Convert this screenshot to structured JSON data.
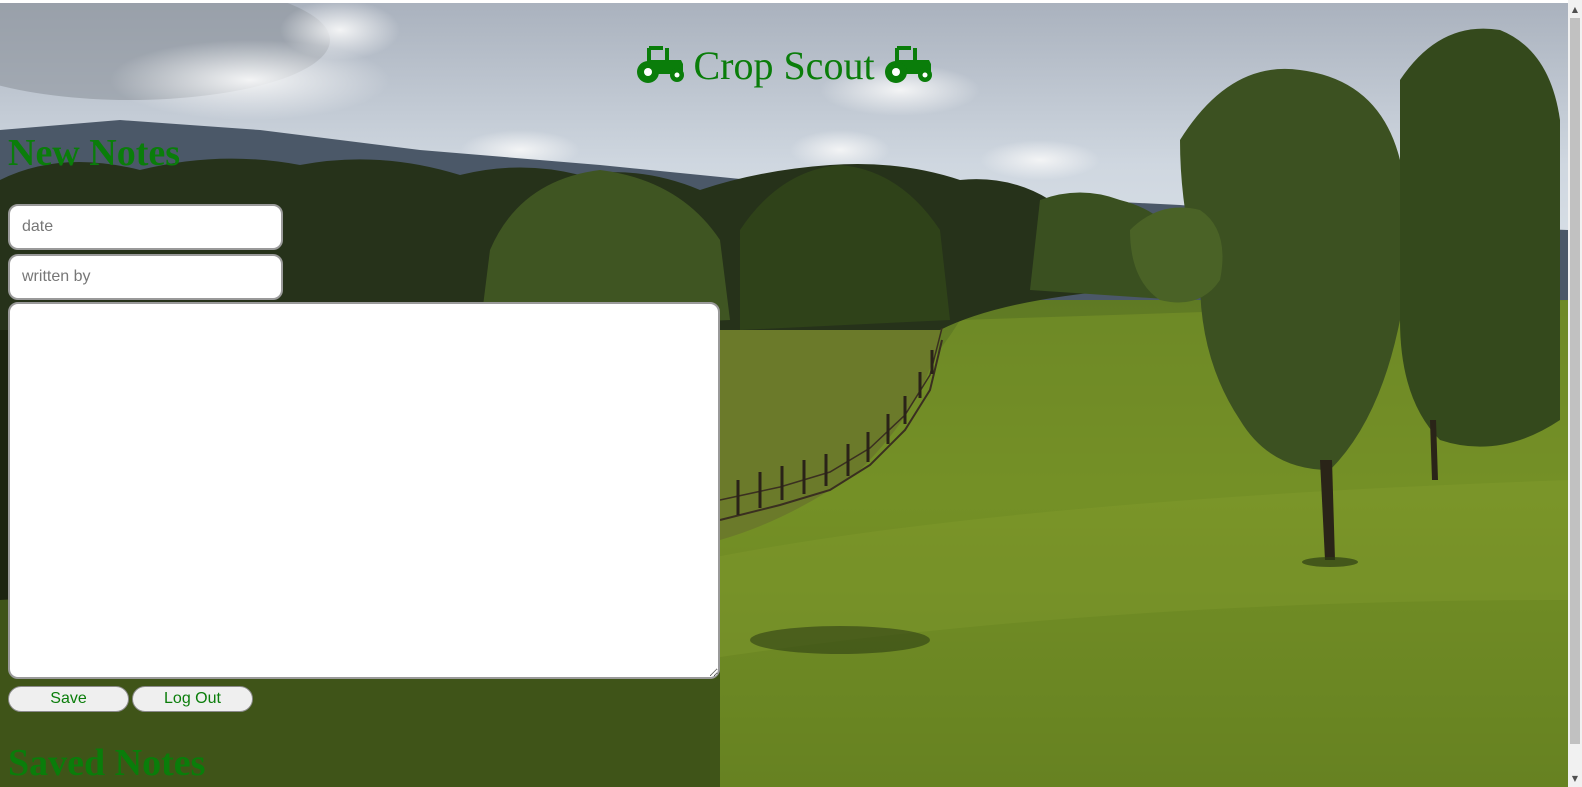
{
  "app": {
    "title": "Crop Scout",
    "title_icon": "tractor-icon",
    "accent_color": "#0a7d0a"
  },
  "new_notes": {
    "heading": "New Notes",
    "date_placeholder": "date",
    "author_placeholder": "written by",
    "note_value": "",
    "save_label": "Save",
    "logout_label": "Log Out"
  },
  "saved_notes": {
    "heading": "Saved Notes"
  },
  "background": {
    "description_icon": "landscape-background-image"
  }
}
